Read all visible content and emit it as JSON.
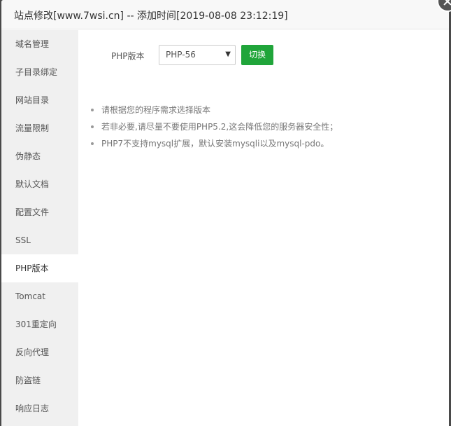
{
  "dialog": {
    "title": "站点修改[www.7wsi.cn] -- 添加时间[2019-08-08 23:12:19]"
  },
  "sidebar": {
    "items": [
      {
        "label": "域名管理",
        "active": false
      },
      {
        "label": "子目录绑定",
        "active": false
      },
      {
        "label": "网站目录",
        "active": false
      },
      {
        "label": "流量限制",
        "active": false
      },
      {
        "label": "伪静态",
        "active": false
      },
      {
        "label": "默认文档",
        "active": false
      },
      {
        "label": "配置文件",
        "active": false
      },
      {
        "label": "SSL",
        "active": false
      },
      {
        "label": "PHP版本",
        "active": true
      },
      {
        "label": "Tomcat",
        "active": false
      },
      {
        "label": "301重定向",
        "active": false
      },
      {
        "label": "反向代理",
        "active": false
      },
      {
        "label": "防盗链",
        "active": false
      },
      {
        "label": "响应日志",
        "active": false
      }
    ]
  },
  "php_panel": {
    "label": "PHP版本",
    "selected_version": "PHP-56",
    "switch_label": "切换",
    "tips": [
      "请根据您的程序需求选择版本",
      "若非必要,请尽量不要使用PHP5.2,这会降低您的服务器安全性；",
      "PHP7不支持mysql扩展，默认安装mysqli以及mysql-pdo。"
    ]
  },
  "colors": {
    "accent": "#20a53a",
    "sidebar_bg": "#f0f0f0",
    "title_bg": "#f8f8f8"
  }
}
